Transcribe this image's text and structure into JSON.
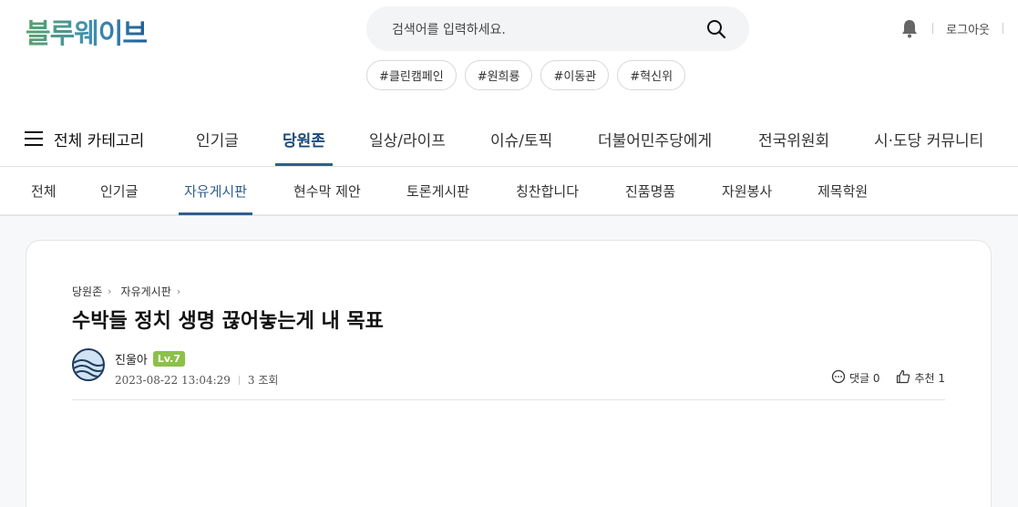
{
  "header": {
    "logo": "블루웨이브",
    "search_placeholder": "검색어를 입력하세요.",
    "logout": "로그아웃",
    "hashtags": [
      "#클린캠페인",
      "#원희룡",
      "#이동관",
      "#혁신위"
    ]
  },
  "mainnav": {
    "all_categories": "전체 카테고리",
    "items": [
      "인기글",
      "당원존",
      "일상/라이프",
      "이슈/토픽",
      "더불어민주당에게",
      "전국위원회",
      "시·도당 커뮤니티"
    ],
    "active": "당원존"
  },
  "subnav": {
    "items": [
      "전체",
      "인기글",
      "자유게시판",
      "현수막 제안",
      "토론게시판",
      "칭찬합니다",
      "진품명품",
      "자원봉사",
      "제목학원"
    ],
    "active": "자유게시판"
  },
  "post": {
    "breadcrumb": [
      "당원존",
      "자유게시판"
    ],
    "title": "수박들 정치 생명 끊어놓는게 내 목표",
    "author": "진울아",
    "level": "Lv.7",
    "date": "2023-08-22 13:04:29",
    "views": "3 조회",
    "comments_label": "댓글 0",
    "likes_label": "추천 1"
  },
  "colors": {
    "accent": "#2f5f8f",
    "level_badge": "#8cc04a"
  },
  "icons": [
    "search-icon",
    "bell-icon",
    "menu-icon",
    "chevron-right-icon",
    "comment-icon",
    "thumbs-up-icon"
  ]
}
